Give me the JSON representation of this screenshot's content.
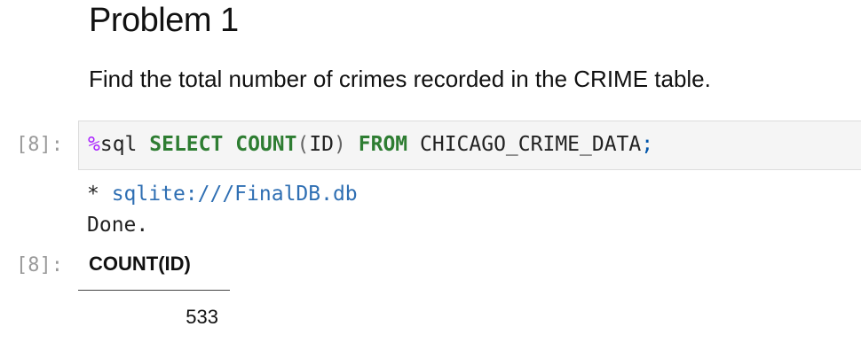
{
  "markdown": {
    "heading": "Problem 1",
    "paragraph": "Find the total number of crimes recorded in the CRIME table."
  },
  "code_cell": {
    "input_prompt": "[8]:",
    "output_prompt": "[8]:",
    "tokens": {
      "magic_symbol": "%",
      "magic_name": "sql",
      "select": "SELECT",
      "count": "COUNT",
      "open_paren": "(",
      "column": "ID",
      "close_paren": ")",
      "from": "FROM",
      "table": "CHICAGO_CRIME_DATA",
      "terminator": ";"
    },
    "stream_output": {
      "bullet": "* ",
      "connection": "sqlite:///FinalDB.db",
      "status": "Done."
    },
    "result_table": {
      "columns": [
        "COUNT(ID)"
      ],
      "rows": [
        [
          "533"
        ]
      ]
    }
  }
}
